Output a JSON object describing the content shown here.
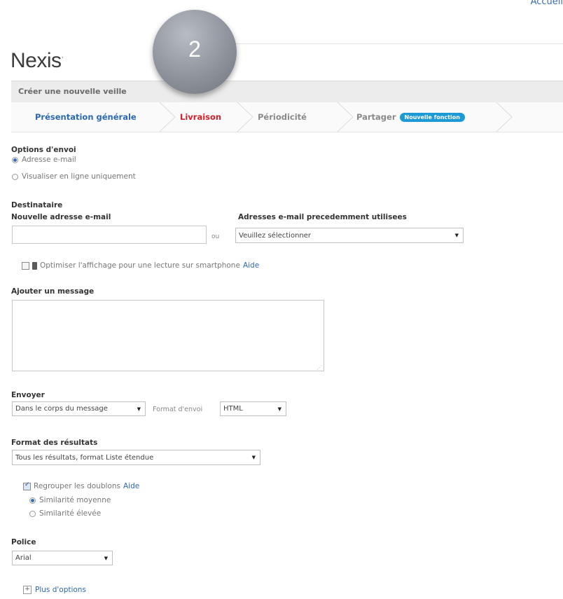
{
  "header": {
    "top_right_link": "Accueil",
    "logo": "Nexis",
    "logo_mark": "·",
    "step_number": "2"
  },
  "page": {
    "title": "Créer une nouvelle veille"
  },
  "tabs": [
    {
      "label": "Présentation générale",
      "state": "done"
    },
    {
      "label": "Livraison",
      "state": "active"
    },
    {
      "label": "Périodicité",
      "state": "pending"
    },
    {
      "label": "Partager",
      "state": "pending",
      "badge": "Nouvelle fonction"
    }
  ],
  "delivery_options": {
    "heading": "Options d'envoi",
    "options": [
      {
        "label": "Adresse e-mail",
        "selected": true
      },
      {
        "label": "Visualiser en ligne uniquement",
        "selected": false
      }
    ]
  },
  "recipient": {
    "heading": "Destinataire",
    "new_email_label": "Nouvelle adresse e-mail",
    "new_email_value": "",
    "or_text": "ou",
    "previous_label": "Adresses e-mail precedemment utilisees",
    "previous_selected": "Veuillez sélectionner",
    "smartphone_checkbox_label": "Optimiser l'affichage pour une lecture sur smartphone",
    "smartphone_checked": false,
    "help_link": "Aide"
  },
  "message": {
    "heading": "Ajouter un message",
    "value": ""
  },
  "send": {
    "heading": "Envoyer",
    "mode_selected": "Dans le corps du message",
    "format_label": "Format d'envoi",
    "format_selected": "HTML"
  },
  "results_format": {
    "heading": "Format des résultats",
    "selected": "Tous les résultats, format Liste étendue"
  },
  "duplicates": {
    "checkbox_label": "Regrouper les doublons",
    "checked": true,
    "help_link": "Aide",
    "options": [
      {
        "label": "Similarité moyenne",
        "selected": true
      },
      {
        "label": "Similarité élevée",
        "selected": false
      }
    ]
  },
  "font": {
    "heading": "Police",
    "selected": "Arial"
  },
  "more": {
    "toggle_symbol": "+",
    "label": "Plus d'options"
  },
  "colors": {
    "accent_blue": "#2b68b3",
    "active_tab_red": "#d0202a",
    "badge_blue": "#1c9ad6"
  }
}
